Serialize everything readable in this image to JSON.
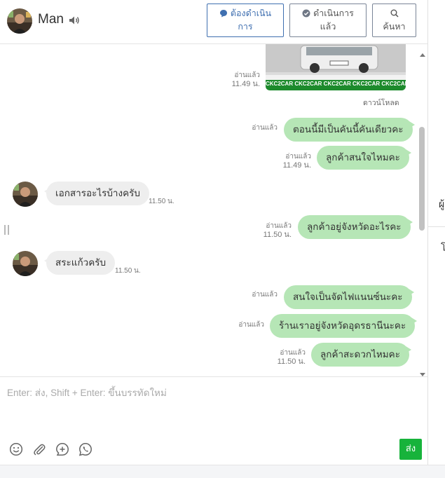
{
  "header": {
    "contact_name": "Man",
    "btn_todo": "ต้องดำเนินการ",
    "btn_done": "ดำเนินการแล้ว",
    "btn_search": "ค้นหา"
  },
  "chat": {
    "image_meta": {
      "status": "อ่านแล้ว",
      "time": "11.49 น."
    },
    "image_banner_text": "CKC2CAR CKC2CAR CKC2CAR CKC2CAR CKC2CAR",
    "download_label": "ดาวน์โหลด",
    "messages": [
      {
        "text": "ตอนนี้มีเป็นคันนี้คันเดียวคะ",
        "status": "อ่านแล้ว",
        "time": ""
      },
      {
        "text": "ลูกค้าสนใจไหมคะ",
        "status": "อ่านแล้ว",
        "time": "11.49 น."
      },
      {
        "text": "เอกสารอะไรบ้างครับ",
        "time": "11.50 น."
      },
      {
        "text": "ลูกค้าอยู่จังหวัดอะไรคะ",
        "status": "อ่านแล้ว",
        "time": "11.50 น."
      },
      {
        "text": "สระแก้วครับ",
        "time": "11.50 น."
      },
      {
        "text": "สนใจเป็นจัดไฟแนนซ์นะคะ",
        "status": "อ่านแล้ว",
        "time": ""
      },
      {
        "text": "ร้านเราอยู่จังหวัดอุดรธานีนะคะ",
        "status": "อ่านแล้ว",
        "time": ""
      },
      {
        "text": "ลูกค้าสะดวกไหมคะ",
        "status": "อ่านแล้ว",
        "time": "11.50 น."
      }
    ]
  },
  "composer": {
    "placeholder": "Enter: ส่ง, Shift + Enter: ขึ้นบรรทัดใหม่",
    "send_label": "ส่ง"
  },
  "side": {
    "char1": "ผู้",
    "char2": "โ"
  },
  "colors": {
    "outgoing_bubble": "#b6e6b6",
    "incoming_bubble": "#eeeeee",
    "send_button": "#17b33b",
    "active_button": "#3f6fb0"
  },
  "icons": [
    "speaker-icon",
    "chat-bubble-icon",
    "check-circle-icon",
    "search-icon",
    "emoji-icon",
    "paperclip-icon",
    "add-circle-icon",
    "whatsapp-icon"
  ]
}
